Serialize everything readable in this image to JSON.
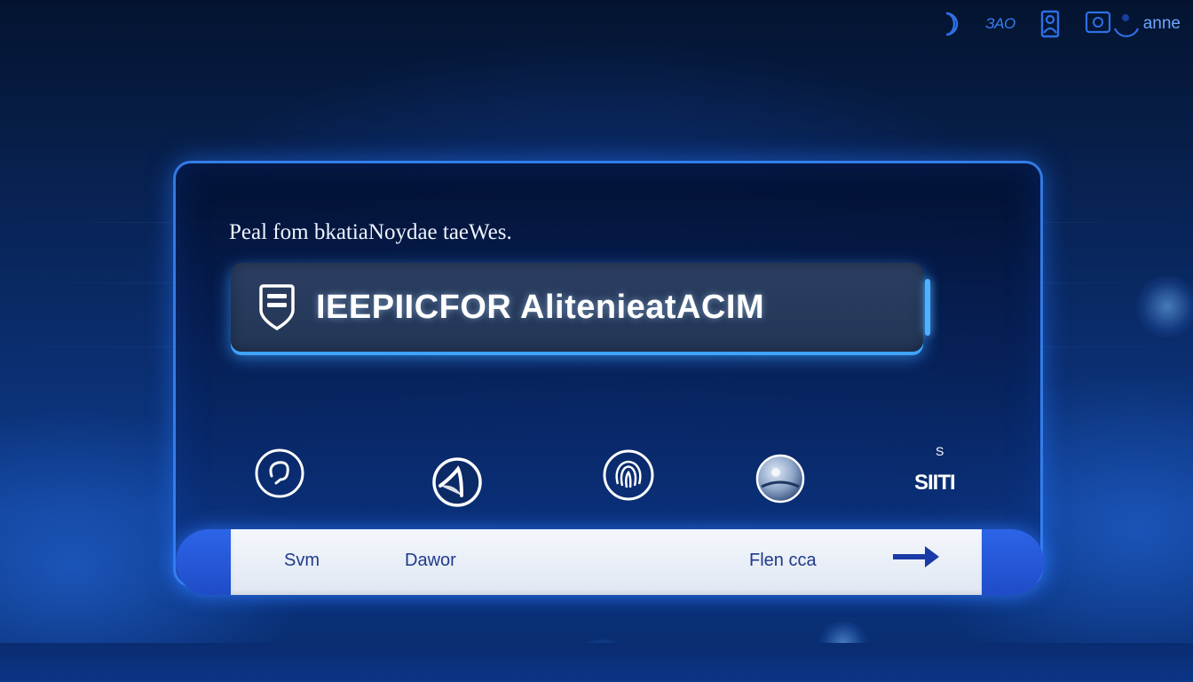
{
  "status_bar": {
    "moon_icon": "moon-icon",
    "text_left": "ЗAO",
    "user_label": "anne"
  },
  "panel": {
    "subtitle": "Peal fom bkatiaNoydae taeWes.",
    "auth_title": "IEEPIICFOR AlitenieatACIM",
    "methods": [
      {
        "icon": "face-id-icon"
      },
      {
        "icon": "voice-icon"
      },
      {
        "icon": "fingerprint-icon"
      },
      {
        "icon": "iris-icon"
      },
      {
        "label": "SIITI",
        "mark": "S"
      }
    ]
  },
  "actions": {
    "first": "Svm",
    "second": "Dawor",
    "third": "Flen cca"
  },
  "colors": {
    "accent": "#2f6fe6",
    "glow": "#3fa4ff",
    "panel_bg": "#061a44",
    "bar_text": "#1e3a8a"
  }
}
